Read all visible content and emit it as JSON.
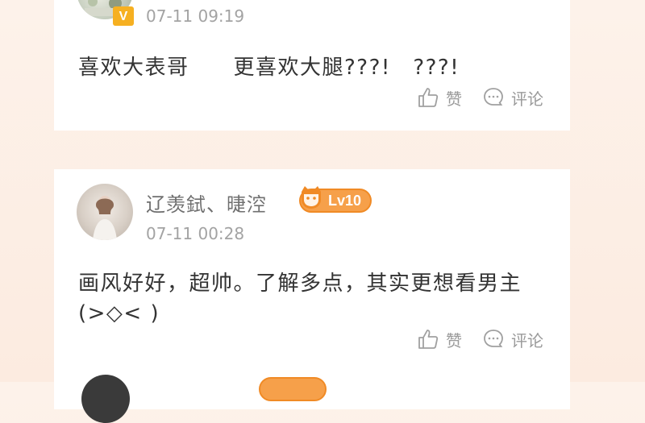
{
  "comments": [
    {
      "time": "07-11 09:19",
      "content": "喜欢大表哥　　更喜欢大腿???!　???!",
      "like_label": "赞",
      "comment_label": "评论",
      "badge_letter": "V"
    },
    {
      "username": "辽羡鉽、㫸涳",
      "level": "Lv10",
      "time": "07-11 00:28",
      "content": "画风好好，超帅。了解多点，其实更想看男主(>◇< )",
      "like_label": "赞",
      "comment_label": "评论"
    }
  ],
  "colors": {
    "accent_orange": "#f6a04a",
    "text_primary": "#333333",
    "text_secondary": "#a3a3a3",
    "background": "#fdf2ea"
  },
  "icons": [
    "thumbs-up-icon",
    "comment-bubble-icon",
    "vip-crown-icon",
    "level-cat-icon"
  ]
}
